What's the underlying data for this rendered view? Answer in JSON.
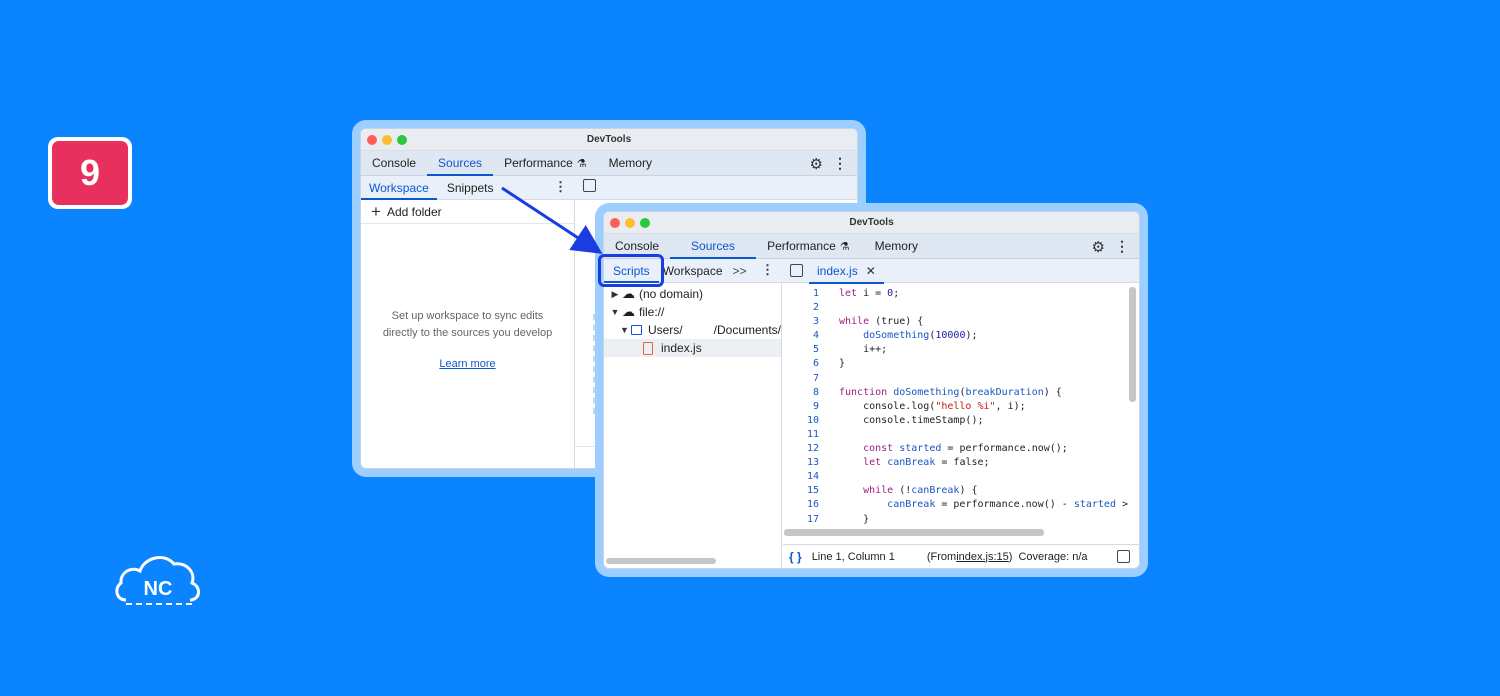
{
  "step_badge": "9",
  "logo_text": "NC",
  "back_window": {
    "title": "DevTools",
    "tabs": [
      "Console",
      "Sources",
      "Performance",
      "Memory"
    ],
    "subtabs": [
      "Workspace",
      "Snippets"
    ],
    "add_folder": "Add folder",
    "empty_message": "Set up workspace to sync edits directly to the sources you develop",
    "learn_more": "Learn more"
  },
  "front_window": {
    "title": "DevTools",
    "tabs": [
      "Console",
      "Sources",
      "Performance",
      "Memory"
    ],
    "subtabs": [
      "Scripts",
      "Workspace"
    ],
    "overflow": ">>",
    "file_tab": "index.js",
    "tree": [
      {
        "label": "(no domain)",
        "expanded": false
      },
      {
        "label": "file://",
        "expanded": true
      },
      {
        "label": "Users/",
        "suffix": "/Documents/",
        "expanded": true
      },
      {
        "label": "index.js"
      }
    ],
    "code_lines": [
      "let i = 0;",
      "",
      "while (true) {",
      "    doSomething(10000);",
      "    i++;",
      "}",
      "",
      "function doSomething(breakDuration) {",
      "    console.log(\"hello %i\", i);",
      "    console.timeStamp();",
      "",
      "    const started = performance.now();",
      "    let canBreak = false;",
      "",
      "    while (!canBreak) {",
      "        canBreak = performance.now() - started >",
      "    }"
    ],
    "status": {
      "position": "Line 1, Column 1",
      "from_prefix": "(From ",
      "from_link": "index.js:15",
      "from_suffix": ")",
      "coverage": "Coverage: n/a"
    }
  },
  "colors": {
    "background": "#0a84ff",
    "badge": "#e8305e",
    "accent": "#0b57d0",
    "highlight": "#1a3de0"
  }
}
